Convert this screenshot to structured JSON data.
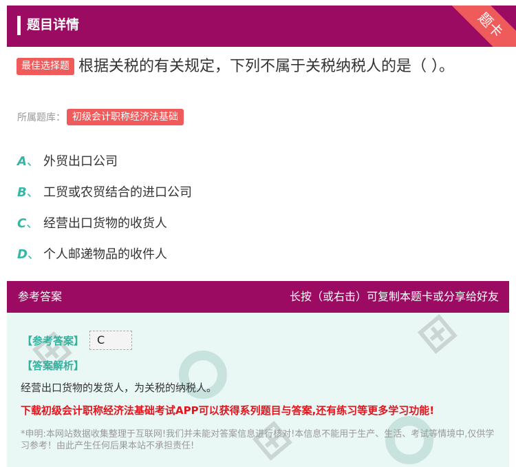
{
  "header": {
    "title": "题目详情",
    "corner_label": "题卡"
  },
  "question": {
    "type_badge": "最佳选择题",
    "text": "根据关税的有关规定，下列不属于关税纳税人的是（ ）。",
    "library_label": "所属题库：",
    "library_name": "初级会计职称经济法基础"
  },
  "options": [
    {
      "letter": "A",
      "sep": "、",
      "text": "外贸出口公司"
    },
    {
      "letter": "B",
      "sep": "、",
      "text": "工贸或农贸结合的进口公司"
    },
    {
      "letter": "C",
      "sep": "、",
      "text": "经营出口货物的收货人"
    },
    {
      "letter": "D",
      "sep": "、",
      "text": "个人邮递物品的收件人"
    }
  ],
  "answer": {
    "section_title": "参考答案",
    "hint": "长按（或右击）可复制本题卡或分享给好友",
    "ref_label": "【参考答案】",
    "ref_value": "C",
    "analysis_label": "【答案解析】",
    "analysis_text": "经营出口货物的发货人，为关税的纳税人。",
    "promo_text": "下载初级会计职称经济法基础考试APP可以获得系列题目与答案,还有练习等更多学习功能!",
    "disclaimer": "*申明:本网站数据收集整理于互联网!我们并未能对答案信息进行核对!本信息不能用于生产、生活、考试等情境中,仅供学习参考！由此产生任何后果本站不承担责任!"
  },
  "colors": {
    "brand": "#9c0b62",
    "accent": "#ef5a5a",
    "teal": "#35b7a8",
    "promo": "#e4141c"
  }
}
